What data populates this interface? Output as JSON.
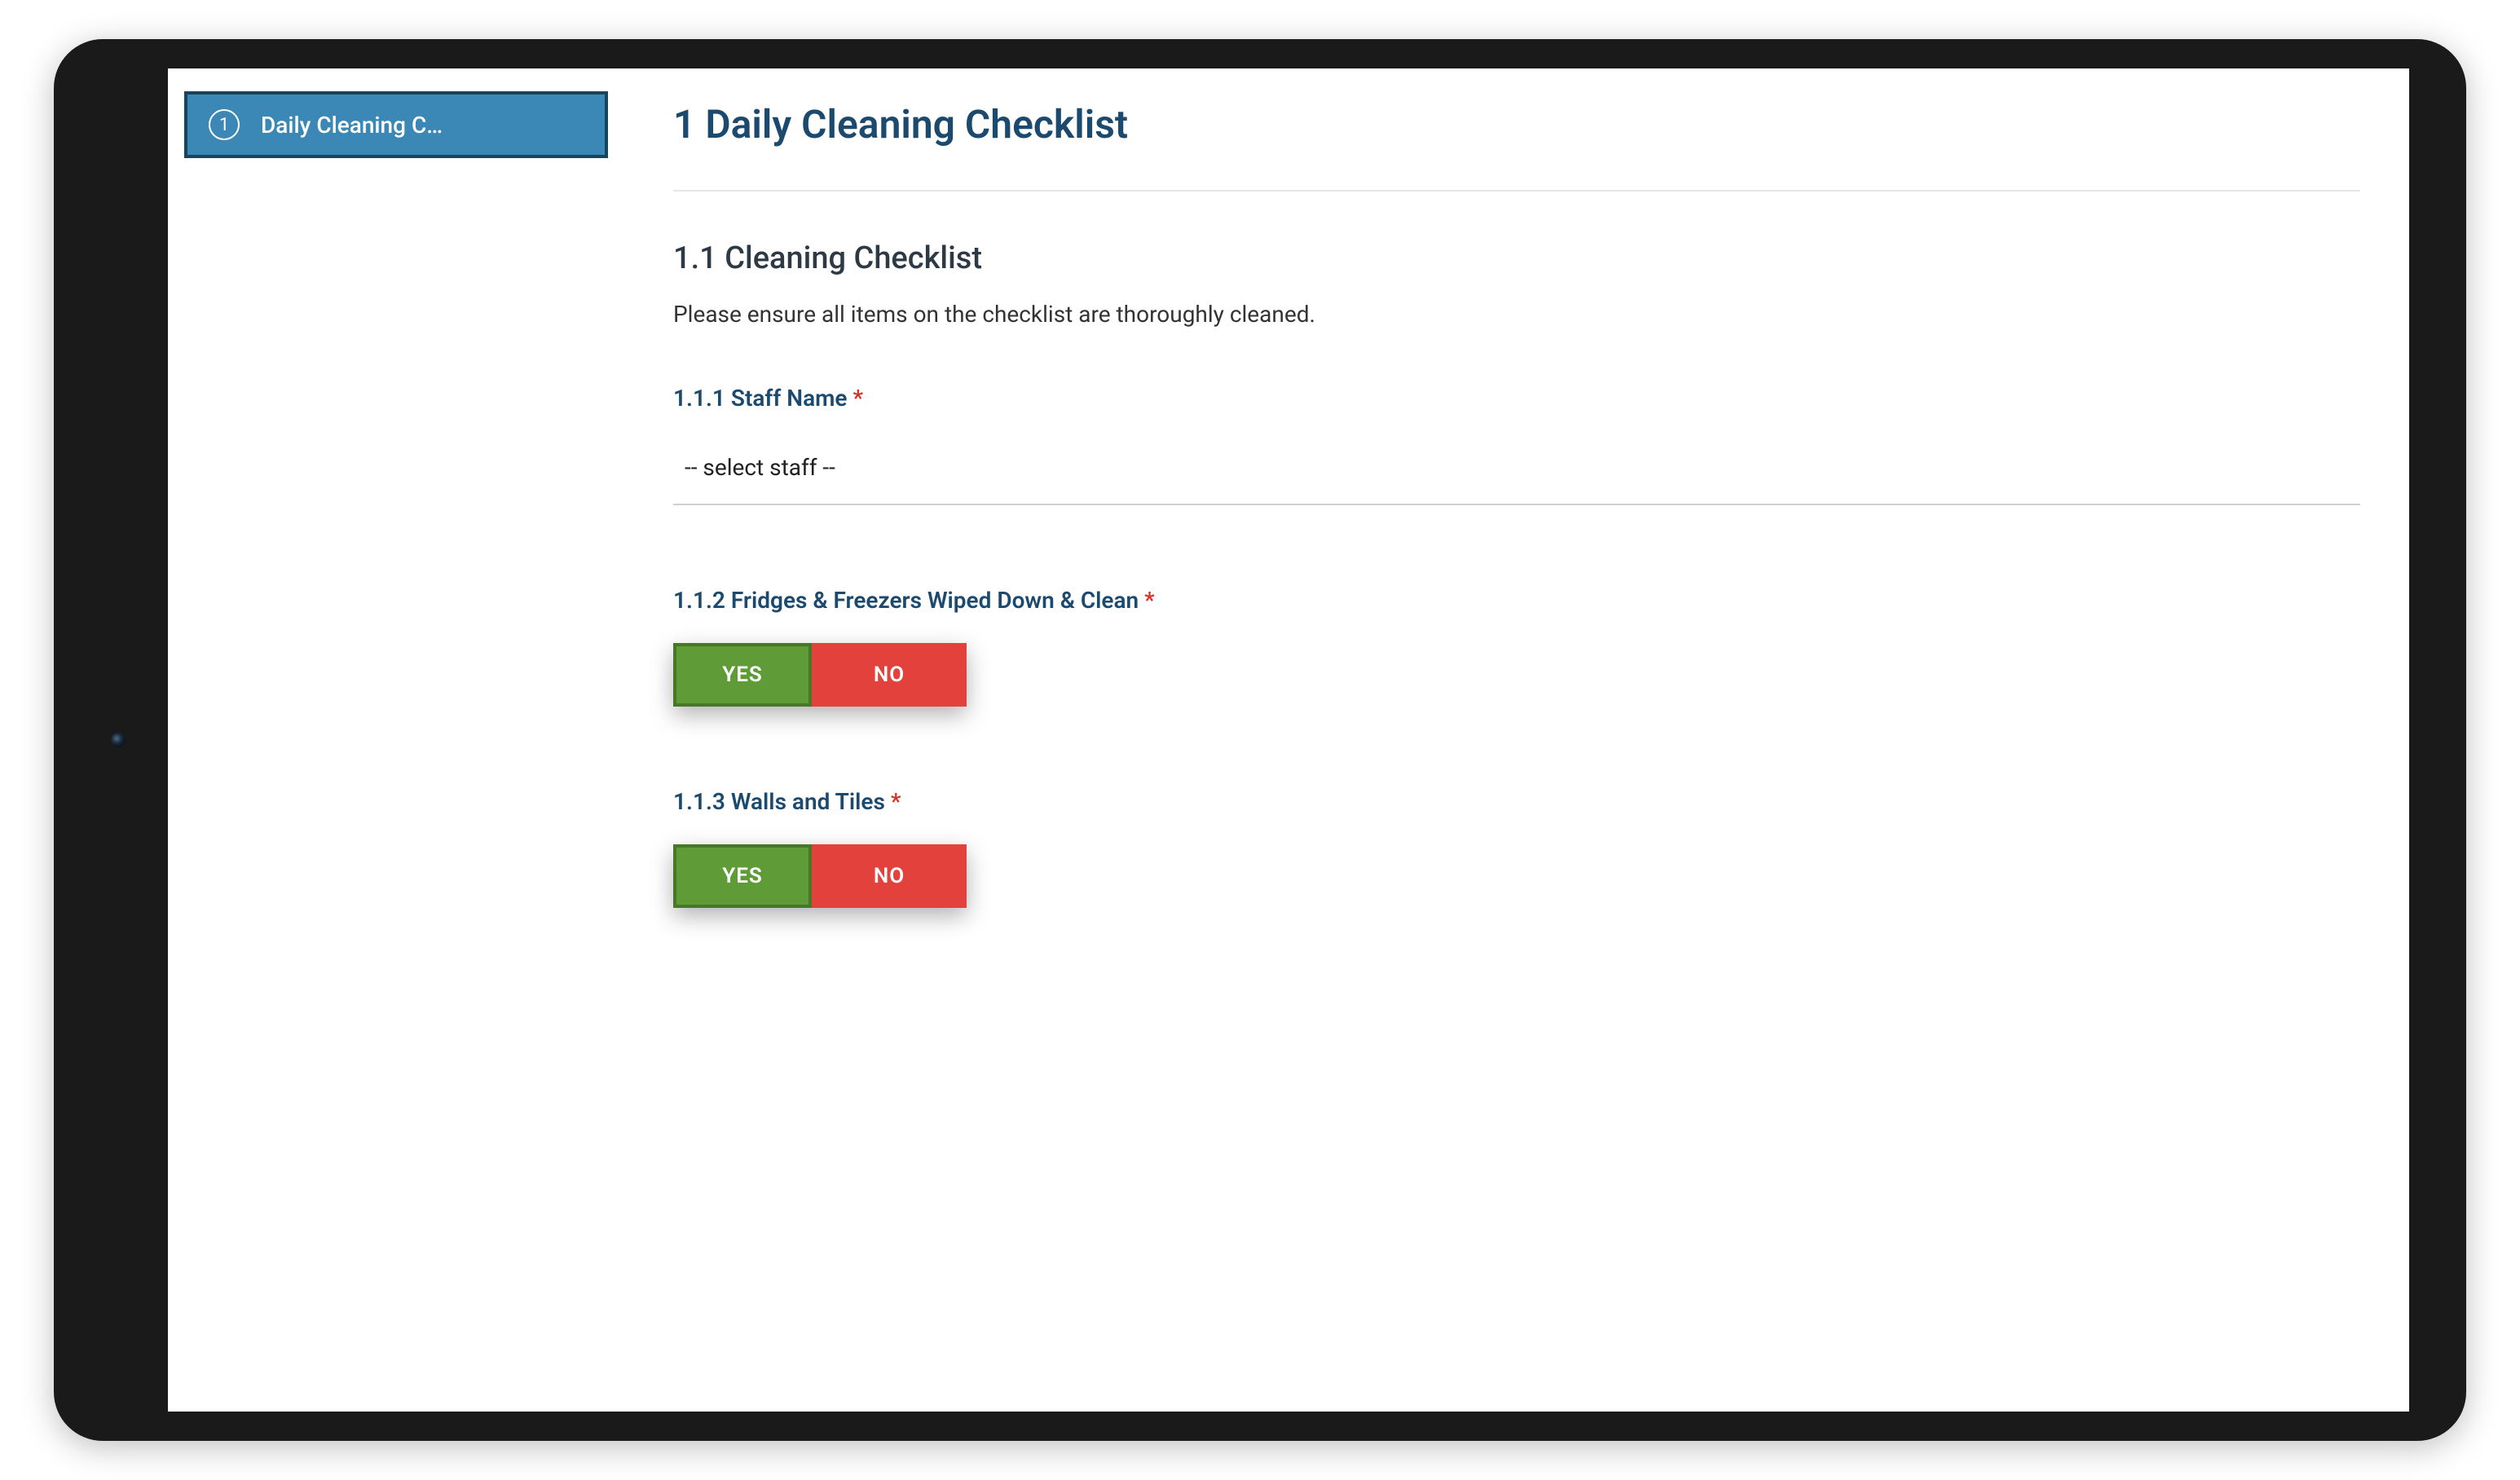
{
  "sidebar": {
    "items": [
      {
        "number": "1",
        "label": "Daily Cleaning C…"
      }
    ]
  },
  "main": {
    "page_title": "1 Daily Cleaning Checklist",
    "section": {
      "number": "1.1",
      "title": "1.1 Cleaning Checklist",
      "description": "Please ensure all items on the checklist are thoroughly cleaned."
    },
    "fields": {
      "staff_name": {
        "label": "1.1.1 Staff Name",
        "required_mark": "*",
        "select_placeholder": "-- select staff --"
      },
      "fridges": {
        "label": "1.1.2 Fridges & Freezers Wiped Down & Clean",
        "required_mark": "*",
        "yes_label": "YES",
        "no_label": "NO",
        "selected": "yes"
      },
      "walls": {
        "label": "1.1.3 Walls and Tiles",
        "required_mark": "*",
        "yes_label": "YES",
        "no_label": "NO",
        "selected": "yes"
      }
    }
  },
  "colors": {
    "sidebar_active_bg": "#3b87b5",
    "sidebar_active_border": "#19445b",
    "heading": "#1c4a6e",
    "yes_btn": "#5f9c38",
    "yes_btn_border": "#487728",
    "no_btn": "#e3413b",
    "required": "#d93025"
  }
}
